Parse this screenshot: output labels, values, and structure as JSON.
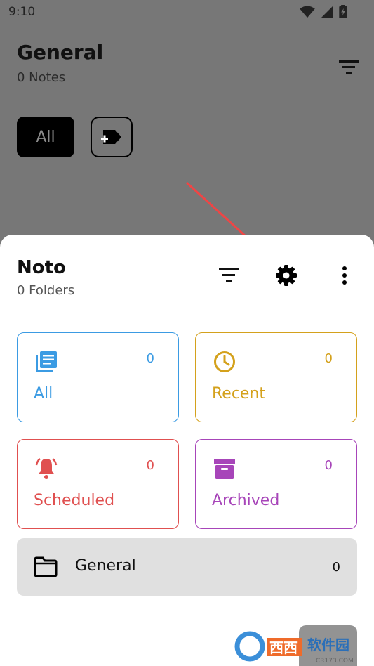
{
  "status_bar": {
    "time": "9:10",
    "icons": [
      "wifi-icon",
      "signal-icon",
      "battery-icon"
    ]
  },
  "background_page": {
    "title": "General",
    "subtitle": "0 Notes",
    "chip_all_label": "All"
  },
  "sheet": {
    "title": "Noto",
    "subtitle": "0 Folders",
    "cards": [
      {
        "key": "all",
        "label": "All",
        "count": "0",
        "icon": "library-books-icon",
        "color": "#3b9be3"
      },
      {
        "key": "recent",
        "label": "Recent",
        "count": "0",
        "icon": "clock-icon",
        "color": "#d4a11c"
      },
      {
        "key": "scheduled",
        "label": "Scheduled",
        "count": "0",
        "icon": "bell-ring-icon",
        "color": "#e05050"
      },
      {
        "key": "archived",
        "label": "Archived",
        "count": "0",
        "icon": "archive-icon",
        "color": "#a745b9"
      }
    ],
    "folder": {
      "name": "General",
      "count": "0",
      "icon": "folder-outline-icon"
    }
  },
  "watermark": {
    "text_cn": "软件园",
    "text_site": "CR173.COM"
  },
  "colors": {
    "scrim": "#777777",
    "sheet_bg": "#ffffff",
    "folder_bg": "#e0e0e0",
    "annotation_arrow": "#ef4545"
  }
}
